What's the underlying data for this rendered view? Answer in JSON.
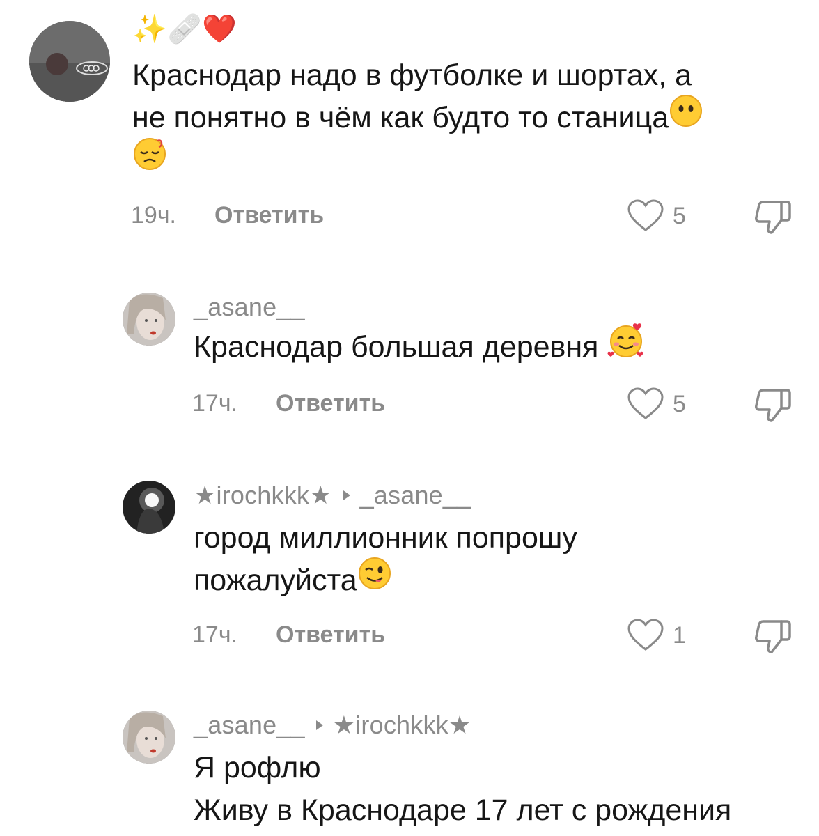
{
  "comments": [
    {
      "username_emoji": "✨🩹❤️",
      "text_lines": [
        "Краснодар надо в футболке и шортах, а",
        "не понятно в чём как будто то станица"
      ],
      "time": "19ч.",
      "reply_label": "Ответить",
      "likes": "5"
    },
    {
      "username": "_asane__",
      "text_lines": [
        "Краснодар большая деревня"
      ],
      "time": "17ч.",
      "reply_label": "Ответить",
      "likes": "5"
    },
    {
      "username": "★irochkkk★",
      "reply_to": "_asane__",
      "text_lines": [
        "город миллионник попрошу",
        "пожалуйста"
      ],
      "time": "17ч.",
      "reply_label": "Ответить",
      "likes": "1"
    },
    {
      "username": "_asane__",
      "reply_to": "★irochkkk★",
      "text_lines": [
        "Я рофлю",
        "Живу в Краснодаре 17 лет с рождения"
      ]
    }
  ],
  "icons": {
    "like": "heart-outline-icon",
    "dislike": "thumbs-down-icon"
  },
  "colors": {
    "text": "#161616",
    "muted": "#8a8a8a",
    "background": "#ffffff"
  }
}
